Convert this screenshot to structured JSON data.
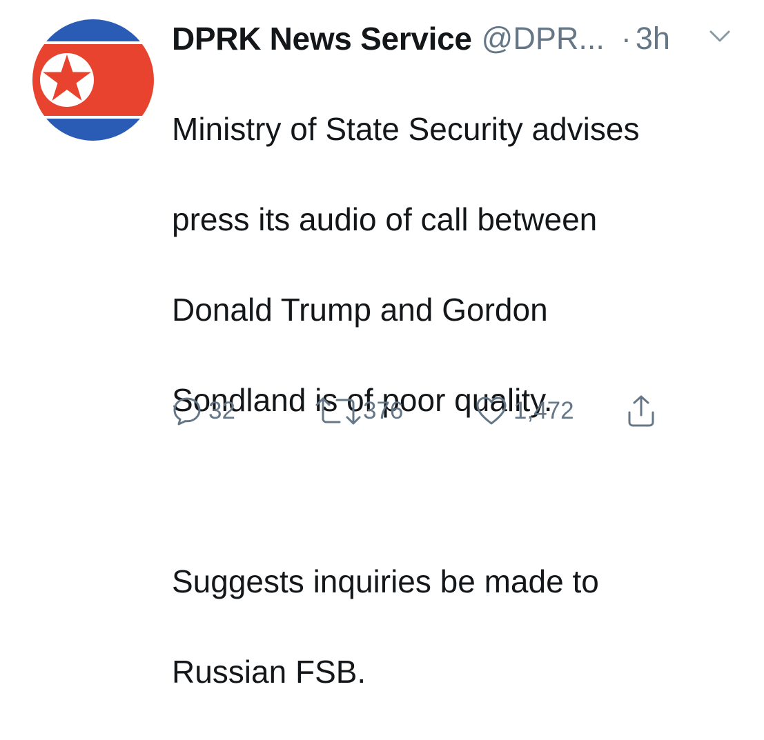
{
  "tweet": {
    "display_name": "DPRK News Service",
    "handle": "@DPR...",
    "separator": "·",
    "time": "3h",
    "text_lines": [
      "Ministry of State Security advises",
      "press its audio of call between",
      "Donald Trump and Gordon",
      "Sondland is of poor quality."
    ],
    "text_lines_2": [
      "Suggests inquiries be made to",
      "Russian FSB."
    ],
    "avatar_icon": "dprk-flag-icon",
    "menu_icon": "chevron-down-icon"
  },
  "actions": {
    "reply": {
      "icon": "reply-icon",
      "count": "32"
    },
    "retweet": {
      "icon": "retweet-icon",
      "count": "376"
    },
    "like": {
      "icon": "heart-icon",
      "count": "1,472"
    },
    "share": {
      "icon": "share-icon"
    }
  },
  "colors": {
    "text": "#14171a",
    "secondary": "#657786",
    "flag_red": "#e8432e",
    "flag_blue": "#2a5bb5",
    "flag_white": "#ffffff"
  }
}
